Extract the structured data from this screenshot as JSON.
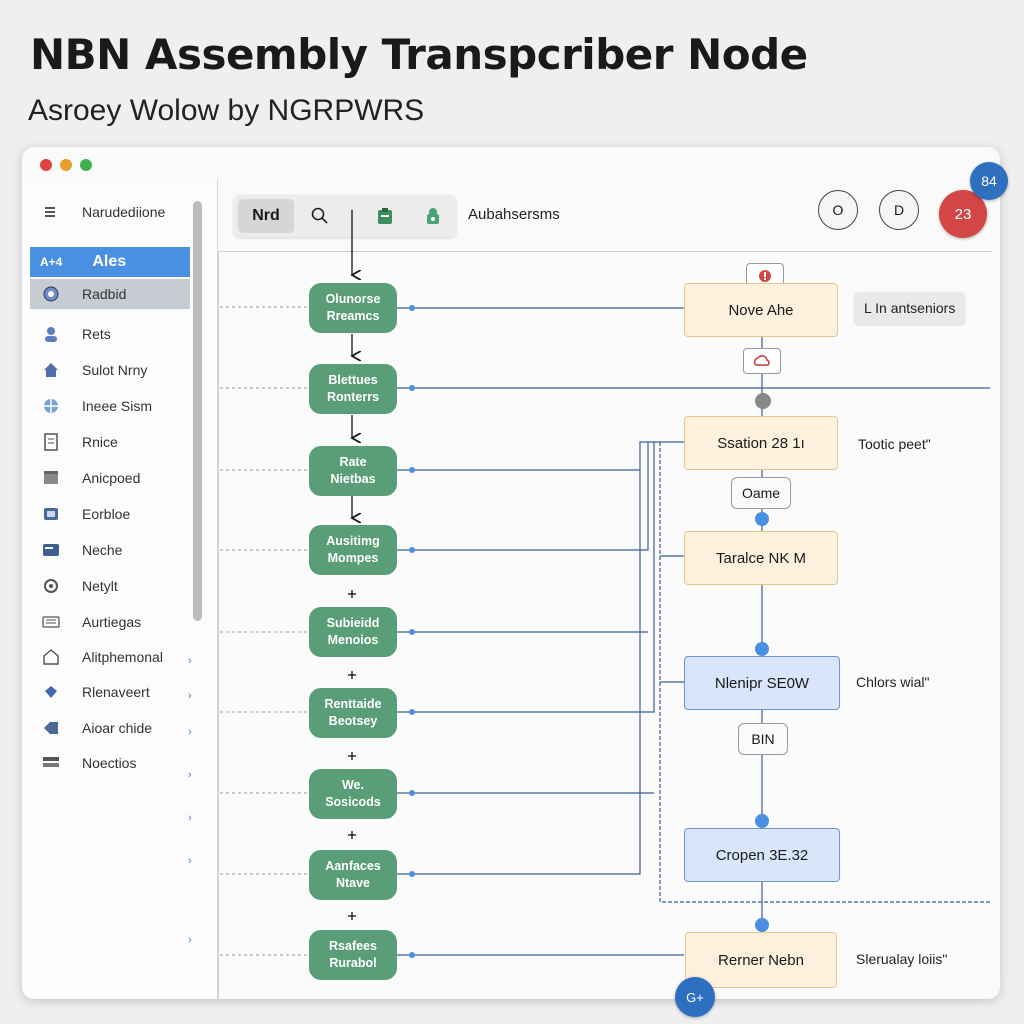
{
  "header": {
    "title": "NBN Assembly Transpcriber Node",
    "subtitle": "Asroey Wolow by NGRPWRS"
  },
  "sidebar": {
    "items": [
      {
        "label": "Narudediione",
        "icon": "menu-icon"
      },
      {
        "label": "Ales",
        "prefix": "A+4",
        "icon": "none"
      },
      {
        "label": "Radbid",
        "icon": "globe-icon"
      },
      {
        "label": "Rets",
        "icon": "person-icon"
      },
      {
        "label": "Sulot Nrny",
        "icon": "house-icon"
      },
      {
        "label": "Ineee Sism",
        "icon": "globe-icon"
      },
      {
        "label": "Rnice",
        "icon": "document-icon"
      },
      {
        "label": "Anicpoed",
        "icon": "box-icon"
      },
      {
        "label": "Eorbloe",
        "icon": "layers-icon"
      },
      {
        "label": "Neche",
        "icon": "card-icon"
      },
      {
        "label": "Netylt",
        "icon": "gear-icon"
      },
      {
        "label": "Aurtiegas",
        "icon": "keyboard-icon"
      },
      {
        "label": "Alitphemonal",
        "icon": "home-outline-icon"
      },
      {
        "label": "Rlenaveert",
        "icon": "diamond-icon"
      },
      {
        "label": "Aioar chide",
        "icon": "tag-icon"
      },
      {
        "label": "Noectios",
        "icon": "stack-icon"
      }
    ]
  },
  "toolbar": {
    "primary_label": "Nrd",
    "label": "Aubahsersms"
  },
  "header_buttons": {
    "btn1": "O",
    "btn2": "D",
    "red": "23",
    "corner_badge": "84",
    "bottom_badge": "G+"
  },
  "flow": {
    "left_nodes": [
      "Olunorse\nRreamcs",
      "Blettues\nRonterrs",
      "Rate\nNietbas",
      "Ausitimg\nMompes",
      "Subieidd\nMenoios",
      "Renttaide\nBeotsey",
      "We.\nSosicods",
      "Aanfaces\nNtave",
      "Rsafees\nRurabol"
    ],
    "right_nodes": [
      {
        "label": "Nove  Ahe",
        "style": "orange"
      },
      {
        "label": "Ssation 28 1ı",
        "style": "orange"
      },
      {
        "label": "Taralce NK M",
        "style": "orange"
      },
      {
        "label": "Nlenipr SE0W",
        "style": "blue"
      },
      {
        "label": "Cropen 3E.32",
        "style": "blue"
      },
      {
        "label": "Rerner Nebn",
        "style": "orange"
      }
    ],
    "pills": {
      "oame": "Oame",
      "bin": "BIN"
    },
    "side_labels": {
      "l1": "L In antseniors",
      "l2": "Tootic peet\"",
      "l3": "Chlors wial\"",
      "l4": "Slerualay loiis\""
    }
  }
}
